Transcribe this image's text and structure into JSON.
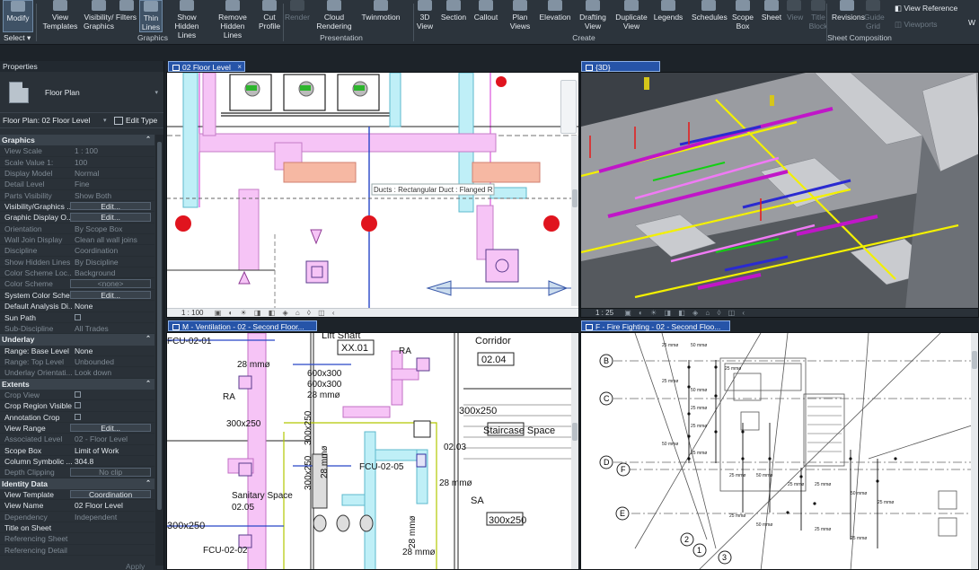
{
  "ribbon": {
    "buttons": [
      {
        "id": "modify",
        "label": "Modify",
        "label2": "",
        "disabled": false,
        "active": true
      },
      {
        "id": "view-templates",
        "label": "View",
        "label2": "Templates",
        "disabled": false,
        "active": false
      },
      {
        "id": "visibility-graphics",
        "label": "Visibility/",
        "label2": "Graphics",
        "disabled": false,
        "active": false
      },
      {
        "id": "filters",
        "label": "Filters",
        "label2": "",
        "disabled": false,
        "active": false
      },
      {
        "id": "thin-lines",
        "label": "Thin",
        "label2": "Lines",
        "disabled": false,
        "active": true
      },
      {
        "id": "show-hidden-lines",
        "label": "Show",
        "label2": "Hidden Lines",
        "disabled": false,
        "active": false
      },
      {
        "id": "remove-hidden-lines",
        "label": "Remove",
        "label2": "Hidden Lines",
        "disabled": false,
        "active": false
      },
      {
        "id": "cut-profile",
        "label": "Cut",
        "label2": "Profile",
        "disabled": false,
        "active": false
      },
      {
        "id": "render",
        "label": "Render",
        "label2": "",
        "disabled": true,
        "active": false
      },
      {
        "id": "cloud-rendering",
        "label": "Cloud",
        "label2": "Rendering",
        "disabled": false,
        "active": false
      },
      {
        "id": "twinmotion",
        "label": "Twinmotion",
        "label2": "",
        "disabled": false,
        "active": false
      },
      {
        "id": "3d-view",
        "label": "3D",
        "label2": "View",
        "disabled": false,
        "active": false
      },
      {
        "id": "section",
        "label": "Section",
        "label2": "",
        "disabled": false,
        "active": false
      },
      {
        "id": "callout",
        "label": "Callout",
        "label2": "",
        "disabled": false,
        "active": false
      },
      {
        "id": "plan-views",
        "label": "Plan",
        "label2": "Views",
        "disabled": false,
        "active": false
      },
      {
        "id": "elevation",
        "label": "Elevation",
        "label2": "",
        "disabled": false,
        "active": false
      },
      {
        "id": "drafting-view",
        "label": "Drafting",
        "label2": "View",
        "disabled": false,
        "active": false
      },
      {
        "id": "duplicate-view",
        "label": "Duplicate",
        "label2": "View",
        "disabled": false,
        "active": false
      },
      {
        "id": "legends",
        "label": "Legends",
        "label2": "",
        "disabled": false,
        "active": false
      },
      {
        "id": "schedules",
        "label": "Schedules",
        "label2": "",
        "disabled": false,
        "active": false
      },
      {
        "id": "scope-box",
        "label": "Scope",
        "label2": "Box",
        "disabled": false,
        "active": false
      },
      {
        "id": "sheet",
        "label": "Sheet",
        "label2": "",
        "disabled": false,
        "active": false
      },
      {
        "id": "view",
        "label": "View",
        "label2": "",
        "disabled": true,
        "active": false
      },
      {
        "id": "title-block",
        "label": "Title",
        "label2": "Block",
        "disabled": true,
        "active": false
      },
      {
        "id": "revisions",
        "label": "Revisions",
        "label2": "",
        "disabled": false,
        "active": false
      },
      {
        "id": "guide-grid",
        "label": "Guide",
        "label2": "Grid",
        "disabled": true,
        "active": false
      }
    ],
    "groups": [
      "Graphics",
      "Presentation",
      "Create",
      "Sheet Composition"
    ],
    "select_label": "Select",
    "view_reference": "View  Reference",
    "viewports": "Viewports",
    "matchline": "",
    "overflow": "W"
  },
  "properties": {
    "title": "Properties",
    "type_name": "Floor Plan",
    "view_selector": "Floor Plan: 02 Floor Level",
    "edit_type": "Edit Type",
    "apply": "Apply",
    "sections": [
      {
        "name": "Graphics",
        "rows": [
          {
            "k": "View Scale",
            "v": "1 : 100",
            "dim": true
          },
          {
            "k": "Scale Value  1:",
            "v": "100",
            "dim": true
          },
          {
            "k": "Display Model",
            "v": "Normal",
            "dim": true
          },
          {
            "k": "Detail Level",
            "v": "Fine",
            "dim": true
          },
          {
            "k": "Parts Visibility",
            "v": "Show Both",
            "dim": true
          },
          {
            "k": "Visibility/Graphics ...",
            "v": "Edit...",
            "btn": true
          },
          {
            "k": "Graphic Display O...",
            "v": "Edit...",
            "btn": true
          },
          {
            "k": "Orientation",
            "v": "By Scope Box",
            "dim": true
          },
          {
            "k": "Wall Join Display",
            "v": "Clean all wall joins",
            "dim": true
          },
          {
            "k": "Discipline",
            "v": "Coordination",
            "dim": true
          },
          {
            "k": "Show Hidden Lines",
            "v": "By Discipline",
            "dim": true
          },
          {
            "k": "Color Scheme Loc...",
            "v": "Background",
            "dim": true
          },
          {
            "k": "Color Scheme",
            "v": "<none>",
            "btn": true,
            "dim": true
          },
          {
            "k": "System Color Sche...",
            "v": "Edit...",
            "btn": true
          },
          {
            "k": "Default Analysis Di...",
            "v": "None"
          },
          {
            "k": "Sun Path",
            "v": "",
            "cb": true
          },
          {
            "k": "Sub-Discipline",
            "v": "All Trades",
            "dim": true
          }
        ]
      },
      {
        "name": "Underlay",
        "rows": [
          {
            "k": "Range: Base Level",
            "v": "None"
          },
          {
            "k": "Range: Top Level",
            "v": "Unbounded",
            "dim": true
          },
          {
            "k": "Underlay Orientati...",
            "v": "Look down",
            "dim": true
          }
        ]
      },
      {
        "name": "Extents",
        "rows": [
          {
            "k": "Crop View",
            "v": "",
            "cb": true,
            "dim": true
          },
          {
            "k": "Crop Region Visible",
            "v": "",
            "cb": true
          },
          {
            "k": "Annotation Crop",
            "v": "",
            "cb": true
          },
          {
            "k": "View Range",
            "v": "Edit...",
            "btn": true
          },
          {
            "k": "Associated Level",
            "v": "02 - Floor Level",
            "dim": true
          },
          {
            "k": "Scope Box",
            "v": "Limit of Work"
          },
          {
            "k": "Column Symbolic ...",
            "v": "304.8"
          },
          {
            "k": "Depth Clipping",
            "v": "No clip",
            "btn": true,
            "dim": true
          }
        ]
      },
      {
        "name": "Identity Data",
        "rows": [
          {
            "k": "View Template",
            "v": "Coordination",
            "btn": true
          },
          {
            "k": "View Name",
            "v": "02 Floor Level"
          },
          {
            "k": "Dependency",
            "v": "Independent",
            "dim": true
          },
          {
            "k": "Title on Sheet",
            "v": ""
          },
          {
            "k": "Referencing Sheet",
            "v": "",
            "dim": true
          },
          {
            "k": "Referencing Detail",
            "v": "",
            "dim": true
          }
        ]
      }
    ]
  },
  "views": {
    "floor": {
      "tab": "02 Floor Level",
      "scale": "1 : 100",
      "tooltip": "Ducts : Rectangular Duct : Flanged R"
    },
    "threeD": {
      "tab": "{3D}",
      "scale": "1 : 25"
    },
    "vent": {
      "tab": "M - Ventilation - 02 - Second Floor...",
      "labels": [
        "FCU-02-01",
        "Lift Shaft",
        "XX.01",
        "Corridor",
        "02.04",
        "RA",
        "28 mmø",
        "600x300",
        "600x300",
        "28 mmø",
        "RA",
        "300x250",
        "300x250",
        "Staircase Space",
        "02.03",
        "FCU-02-05",
        "28 mmø",
        "28 mmø",
        "SA",
        "300x250",
        "300x250",
        "Sanitary Space",
        "02.05",
        "FCU-02-02",
        "28 mmø",
        "28 mmø",
        "300x250",
        "300x250"
      ]
    },
    "fire": {
      "tab": "F - Fire Fighting - 02 - Second Floo...",
      "grids": [
        "B",
        "C",
        "D",
        "F",
        "E",
        "2",
        "1",
        "3"
      ],
      "pipe_label": "25 mmø",
      "pipe_label_b": "50 mmø"
    }
  },
  "colors": {
    "accent": "#2654a8",
    "duct_pink": "#e59ee6",
    "duct_cyan": "#8fe0f0",
    "sprinkler_red": "#e0141e",
    "magenta": "#c016c8"
  }
}
